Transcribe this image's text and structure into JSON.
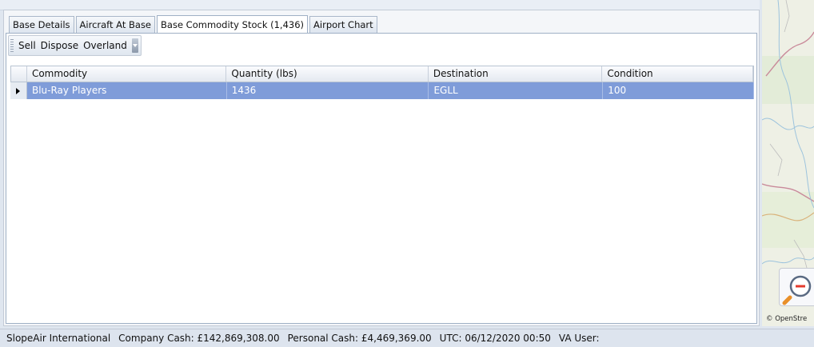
{
  "tabs": [
    {
      "label": "Base Details"
    },
    {
      "label": "Aircraft At Base"
    },
    {
      "label": "Base Commodity Stock (1,436)"
    },
    {
      "label": "Airport Chart"
    }
  ],
  "toolbar": {
    "sell_label": "Sell",
    "dispose_label": "Dispose",
    "overland_label": "Overland"
  },
  "grid": {
    "columns": [
      "Commodity",
      "Quantity (lbs)",
      "Destination",
      "Condition"
    ],
    "rows": [
      {
        "commodity": "Blu-Ray Players",
        "quantity": "1436",
        "destination": "EGLL",
        "condition": "100"
      }
    ]
  },
  "map": {
    "credit": "© OpenStre"
  },
  "status_bar": {
    "company": "SlopeAir International",
    "company_cash": "Company Cash: £142,869,308.00",
    "personal_cash": "Personal Cash: £4,469,369.00",
    "utc": "UTC: 06/12/2020 00:50",
    "va_user": "VA User:"
  },
  "colors": {
    "selected_row": "#7f9cd9",
    "panel_border": "#9fb0c5"
  }
}
